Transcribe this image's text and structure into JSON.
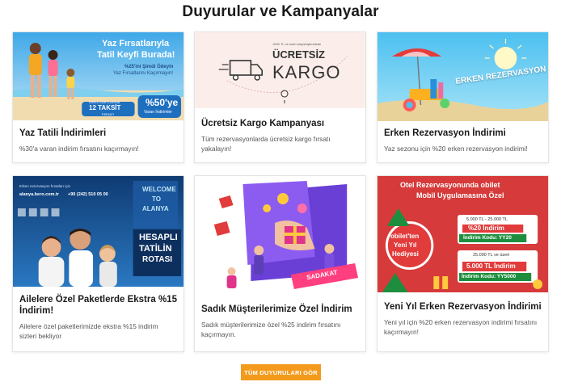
{
  "page_title": "Duyurular ve Kampanyalar",
  "colors": {
    "accent_orange": "#f39a1d",
    "banner_blue": "#2a8fd8",
    "banner_red": "#d63a3a",
    "banner_green": "#1e8e3e"
  },
  "cards": [
    {
      "title": "Yaz Tatili İndirimleri",
      "description": "%30'a varan indirim fırsatını kaçırmayın!",
      "image": {
        "headline_1": "Yaz Fırsatlarıyla",
        "headline_2": "Tatil Keyfi Burada!",
        "sub_1": "%25'ini Şimdi Ödeyin",
        "sub_2": "Yaz Fırsatlarını Kaçırmayın!",
        "installment_small": "KREDİ KARTLARINA",
        "installment": "12 TAKSİT",
        "installment_sub": "FIRSATI",
        "discount": "%50'ye",
        "discount_sub": "Varan İndirimler"
      }
    },
    {
      "title": "Ücretsiz Kargo Kampanyası",
      "description": "Tüm rezervasyonlarda ücretsiz kargo fırsatı yakalayın!",
      "image": {
        "small": "1000 TL ve üzeri alışverişlerinizde",
        "headline_1": "ÜCRETSİZ",
        "headline_2": "KARGO"
      }
    },
    {
      "title": "Erken Rezervasyon İndirimi",
      "description": "Yaz sezonu için %20 erken rezervasyon indirimi!",
      "image": {
        "headline": "ERKEN REZERVASYON"
      }
    },
    {
      "title": "Ailelere Özel Paketlerde Ekstra %15 İndirim!",
      "description": "Ailelere özel paketlerimizde ekstra %15 indirim sizleri bekliyor",
      "image": {
        "top_small": "Erken rezervasyon fırsatları için",
        "site": "alanya.bero.com.tr",
        "phone": "+90 (242) 510 05 00",
        "welcome_1": "WELCOME",
        "welcome_2": "TO",
        "welcome_3": "ALANYA",
        "headline_1": "HESAPLI",
        "headline_2": "TATİLİN",
        "headline_3": "ROTASI"
      }
    },
    {
      "title": "Sadık Müşterilerimize Özel İndirim",
      "description": "Sadık müşterilerimize özel %25 indirim fırsatını kaçırmayın.",
      "image": {
        "ribbon": "SADAKAT"
      }
    },
    {
      "title": "Yeni Yıl Erken Rezervasyon İndirimi",
      "description": "Yeni yıl için %20 erken rezervasyon indirimi fırsatını kaçırmayın!",
      "image": {
        "headline_1": "Otel Rezervasyonunda obilet",
        "headline_2": "Mobil Uygulamasına Özel",
        "circle_1": "obilet'ten",
        "circle_2": "Yeni Yıl",
        "circle_3": "Hediyesi",
        "offer1_range": "5.000 TL - 25.000 TL",
        "offer1_value": "%20 İndirim",
        "offer1_code": "İndirim Kodu: YY20",
        "offer2_range": "25.000 TL ve üzeri",
        "offer2_value": "5.000 TL İndirim",
        "offer2_code": "İndirim Kodu: YY5000"
      }
    }
  ],
  "all_button_label": "TÜM DUYURULARI GÖR"
}
